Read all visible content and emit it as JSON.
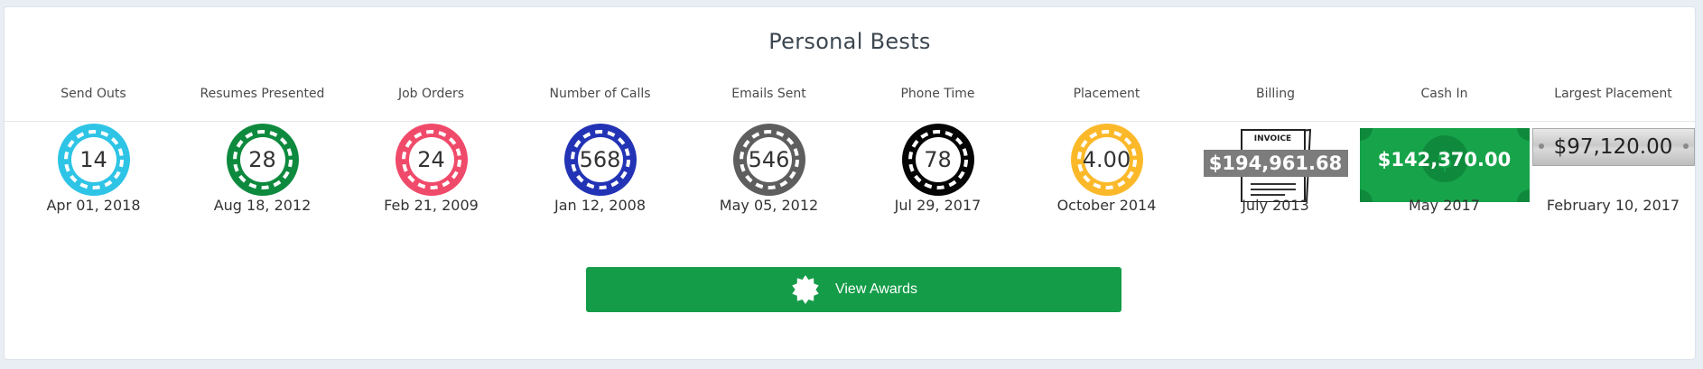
{
  "panel": {
    "title": "Personal Bests"
  },
  "bests": [
    {
      "label": "Send Outs",
      "value": "14",
      "date": "Apr 01, 2018",
      "color": "#2ec4e6"
    },
    {
      "label": "Resumes Presented",
      "value": "28",
      "date": "Aug 18, 2012",
      "color": "#0e8a3e"
    },
    {
      "label": "Job Orders",
      "value": "24",
      "date": "Feb 21, 2009",
      "color": "#f04a6a"
    },
    {
      "label": "Number of Calls",
      "value": "568",
      "date": "Jan 12, 2008",
      "color": "#2233b5"
    },
    {
      "label": "Emails Sent",
      "value": "546",
      "date": "May 05, 2012",
      "color": "#5e5e5e"
    },
    {
      "label": "Phone Time",
      "value": "78",
      "date": "Jul 29, 2017",
      "color": "#050505"
    },
    {
      "label": "Placement",
      "value": "4.00",
      "date": "October 2014",
      "color": "#fbb92a"
    },
    {
      "label": "Billing",
      "value": "$194,961.68",
      "date": "July 2013",
      "invoice_text": "INVOICE"
    },
    {
      "label": "Cash In",
      "value": "$142,370.00",
      "date": "May 2017",
      "color": "#17a34a"
    },
    {
      "label": "Largest Placement",
      "value": "$97,120.00",
      "date": "February 10, 2017"
    }
  ],
  "actions": {
    "view_awards_label": "View Awards",
    "view_awards_icon": "award-seal-icon",
    "button_color": "#149c48"
  }
}
